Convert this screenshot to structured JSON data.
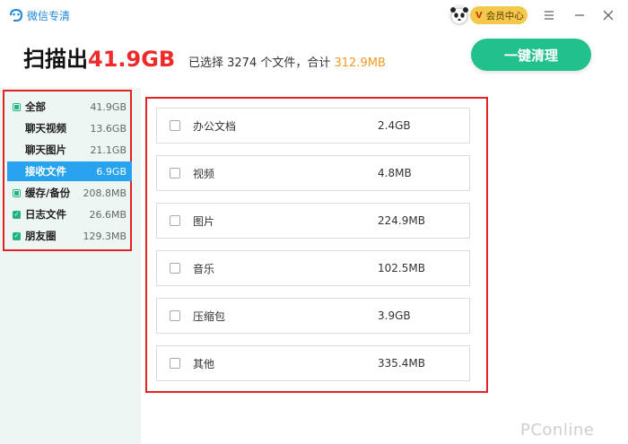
{
  "app": {
    "name": "微信专清"
  },
  "titlebar": {
    "member_label": "会员中心",
    "member_badge": "V"
  },
  "header": {
    "scan_prefix": "扫描出",
    "scan_size": "41.9GB",
    "selected_text": "已选择 3274 个文件，合计",
    "selected_total": "312.9MB",
    "clean_button": "一键清理"
  },
  "sidebar": {
    "items": [
      {
        "label": "全部",
        "value": "41.9GB",
        "check": "partial"
      },
      {
        "label": "聊天视频",
        "value": "13.6GB",
        "check": "none"
      },
      {
        "label": "聊天图片",
        "value": "21.1GB",
        "check": "none"
      },
      {
        "label": "接收文件",
        "value": "6.9GB",
        "check": "none",
        "active": true
      },
      {
        "label": "缓存/备份",
        "value": "208.8MB",
        "check": "partial"
      },
      {
        "label": "日志文件",
        "value": "26.6MB",
        "check": "checked"
      },
      {
        "label": "朋友圈",
        "value": "129.3MB",
        "check": "checked"
      }
    ]
  },
  "files": [
    {
      "name": "办公文档",
      "size": "2.4GB"
    },
    {
      "name": "视频",
      "size": "4.8MB"
    },
    {
      "name": "图片",
      "size": "224.9MB"
    },
    {
      "name": "音乐",
      "size": "102.5MB"
    },
    {
      "name": "压缩包",
      "size": "3.9GB"
    },
    {
      "name": "其他",
      "size": "335.4MB"
    }
  ],
  "watermark": "PConline",
  "colors": {
    "accent_green": "#22c08c",
    "active_blue": "#27a3f0",
    "highlight_red": "#ee2a2a",
    "total_orange": "#f39a1e"
  }
}
